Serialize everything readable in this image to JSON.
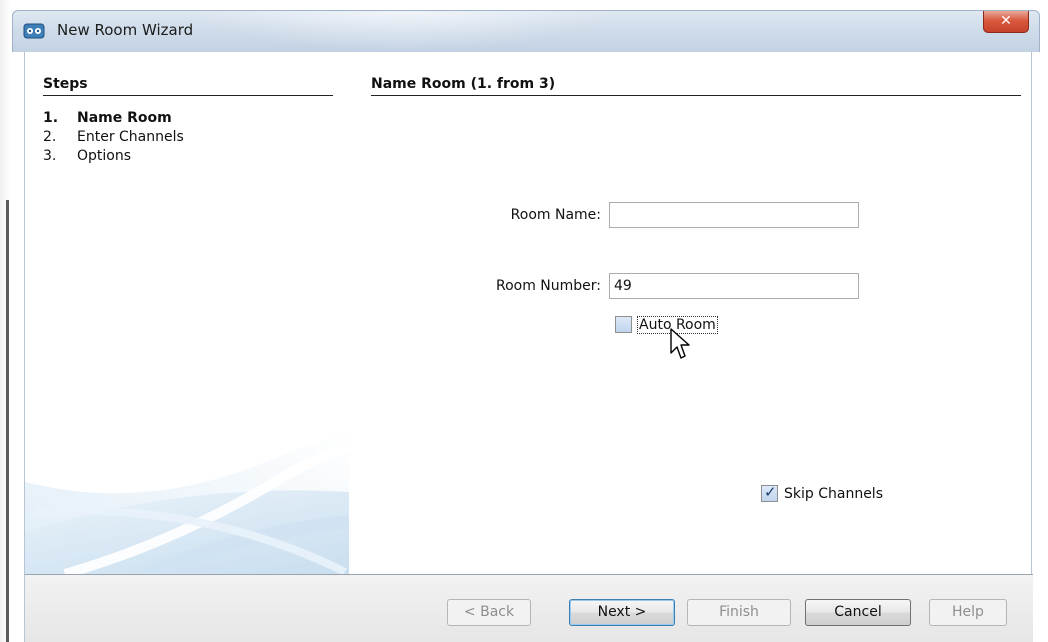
{
  "window": {
    "title": "New Room Wizard",
    "close_glyph": "✕"
  },
  "steps": {
    "heading": "Steps",
    "items": [
      {
        "number": "1.",
        "label": "Name Room",
        "active": true
      },
      {
        "number": "2.",
        "label": "Enter Channels",
        "active": false
      },
      {
        "number": "3.",
        "label": "Options",
        "active": false
      }
    ]
  },
  "content": {
    "heading": "Name Room (1. from 3)",
    "room_name": {
      "label": "Room Name:",
      "value": ""
    },
    "room_number": {
      "label": "Room Number:",
      "value": "49"
    },
    "auto_room": {
      "label": "Auto Room",
      "checked": false
    },
    "skip_channels": {
      "label": "Skip Channels",
      "checked": true
    }
  },
  "buttons": {
    "back": "< Back",
    "next": "Next >",
    "finish": "Finish",
    "cancel": "Cancel",
    "help": "Help"
  },
  "icons": {
    "app": "wizard-app-icon",
    "cursor": "mouse-pointer-icon"
  }
}
